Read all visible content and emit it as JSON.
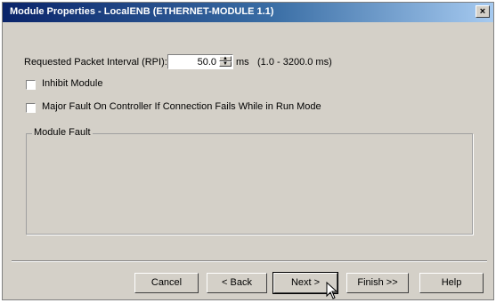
{
  "window": {
    "title": "Module Properties - LocalENB (ETHERNET-MODULE 1.1)",
    "close_label": "×"
  },
  "rpi": {
    "label": "Requested Packet Interval (RPI):",
    "value": "50.0",
    "unit": "ms",
    "range": "(1.0 - 3200.0 ms)"
  },
  "options": {
    "inhibit_label": "Inhibit Module",
    "inhibit_checked": false,
    "major_fault_label": "Major Fault On Controller If Connection Fails While in Run Mode",
    "major_fault_checked": false
  },
  "fault_group": {
    "label": "Module Fault",
    "text": ""
  },
  "buttons": {
    "cancel": "Cancel",
    "back": "< Back",
    "next": "Next >",
    "finish": "Finish >>",
    "help": "Help"
  },
  "colors": {
    "title_start": "#0a246a",
    "title_end": "#a6caf0",
    "face": "#d4d0c8"
  }
}
